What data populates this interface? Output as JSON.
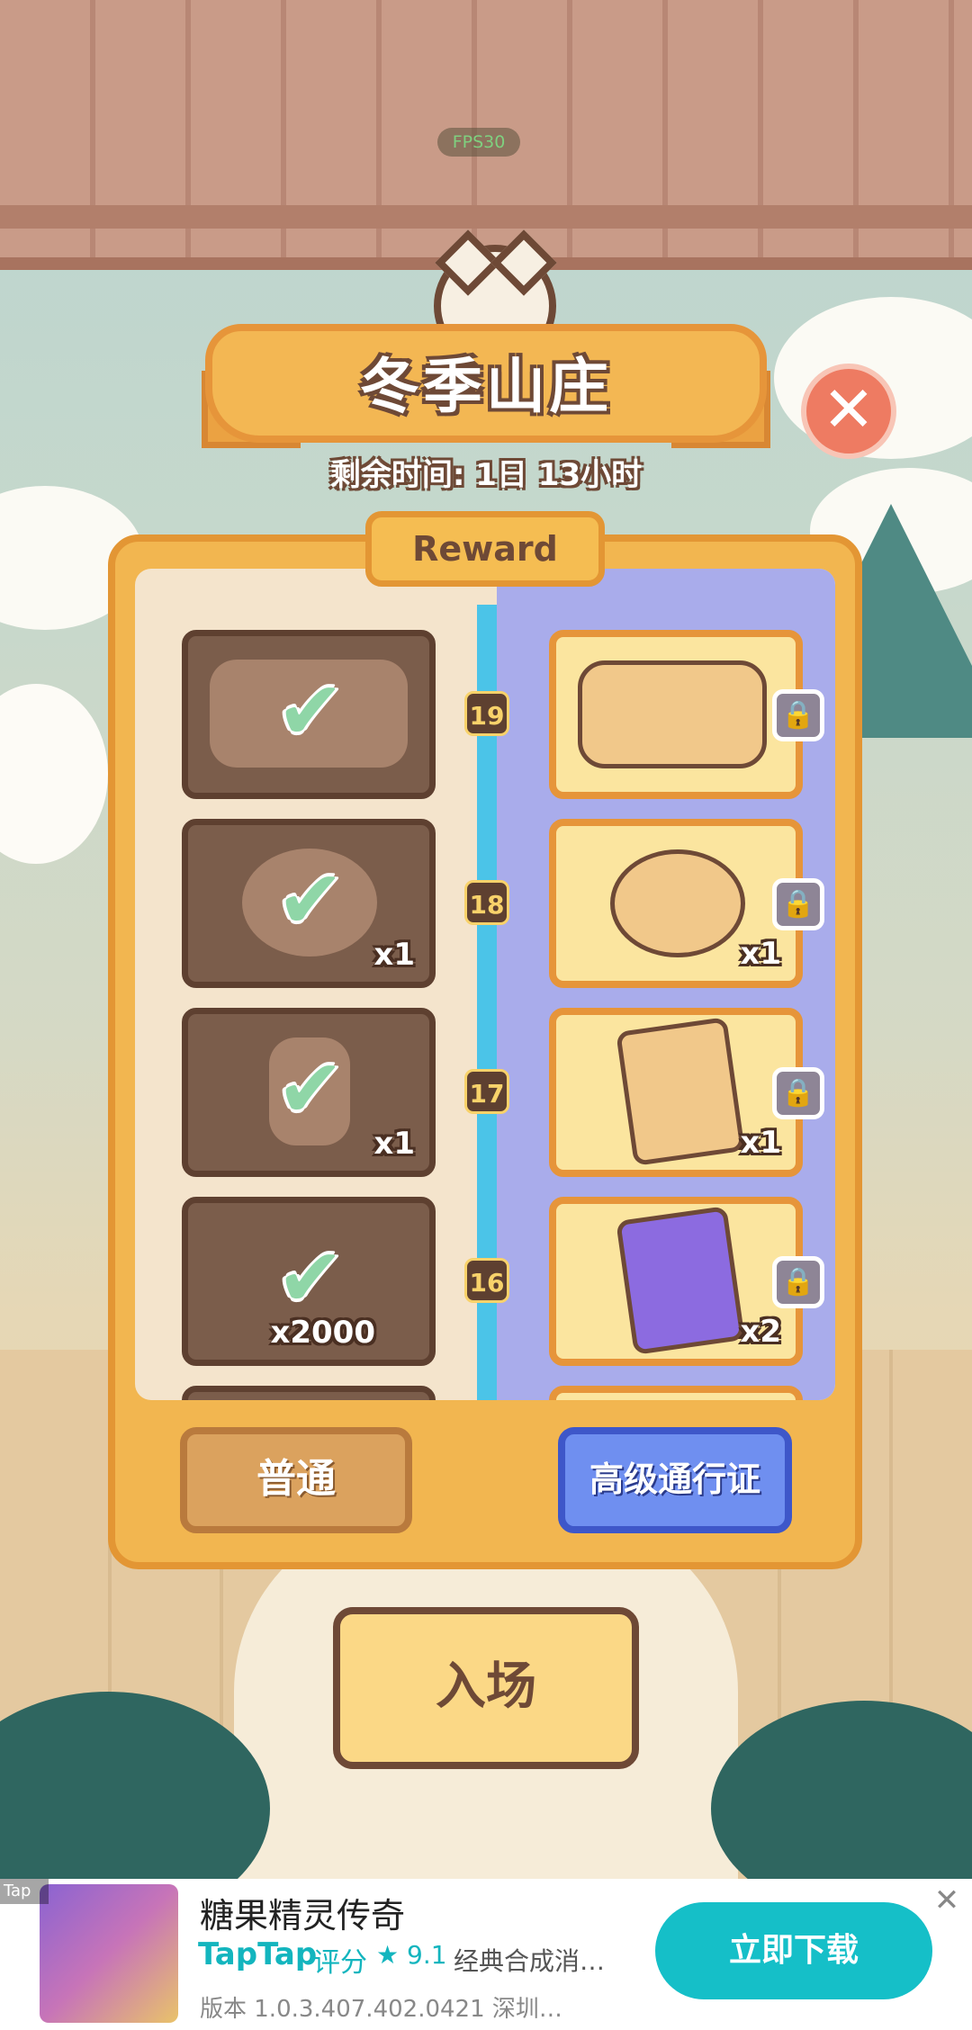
{
  "hud": {
    "fps": "FPS30"
  },
  "event": {
    "title": "冬季山庄",
    "time_remaining": "剩余时间: 1日 13小时",
    "close_label": "✕",
    "tab_label": "Reward"
  },
  "rewards": [
    {
      "level": "19",
      "free_qty": "",
      "premium_qty": "",
      "free_claimed": true
    },
    {
      "level": "18",
      "free_qty": "x1",
      "premium_qty": "x1",
      "free_claimed": true
    },
    {
      "level": "17",
      "free_qty": "x1",
      "premium_qty": "x1",
      "free_claimed": true
    },
    {
      "level": "16",
      "free_qty": "x2000",
      "premium_qty": "x2",
      "free_claimed": true
    }
  ],
  "buttons": {
    "normal": "普通",
    "premium": "高级通行证",
    "enter": "入场"
  },
  "ad": {
    "tag": "Tap",
    "title": "糖果精灵传奇",
    "brand": "TapTap",
    "score_label": "评分",
    "score": "★ 9.1",
    "description": "经典合成消…",
    "version": "版本 1.0.3.407.402.0421  深圳…",
    "download": "立即下载",
    "close": "✕"
  },
  "colors": {
    "panel": "#f2b650",
    "premium_column": "#a9aceb",
    "track": "#4bc4e8",
    "download_button": "#15bfc8"
  }
}
